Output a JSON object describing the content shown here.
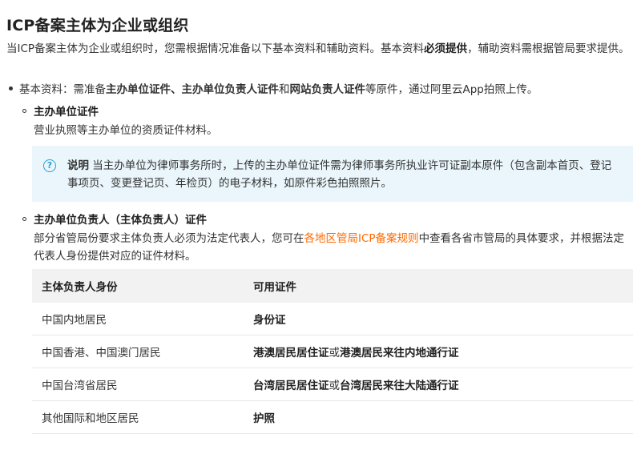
{
  "title": "ICP备案主体为企业或组织",
  "intro": {
    "part1": "当ICP备案主体为企业或组织时，您需根据情况准备以下基本资料和辅助资料。基本资料",
    "bold": "必须提供",
    "part2": "，辅助资料需根据管局要求提供。"
  },
  "basic": {
    "prefix": "基本资料：需准备",
    "b1": "主办单位证件",
    "sep1": "、",
    "b2": "主办单位负责人证件",
    "sep2": "和",
    "b3": "网站负责人证件",
    "suffix": "等原件，通过阿里云App拍照上传。"
  },
  "unit_cert": {
    "title": "主办单位证件",
    "desc": "营业执照等主办单位的资质证件材料。"
  },
  "note": {
    "icon": "question-circle-icon",
    "label": "说明",
    "text": " 当主办单位为律师事务所时，上传的主办单位证件需为律师事务所执业许可证副本原件（包含副本首页、登记事项页、变更登记页、年检页）的电子材料，如原件彩色拍照照片。"
  },
  "owner_cert": {
    "title": "主办单位负责人（主体负责人）证件",
    "desc_pre": "部分省管局份要求主体负责人必须为法定代表人，您可在",
    "link": "各地区管局ICP备案规则",
    "desc_post": "中查看各省市管局的具体要求，并根据法定代表人身份提供对应的证件材料。"
  },
  "table": {
    "headers": [
      "主体负责人身份",
      "可用证件"
    ],
    "rows": [
      {
        "identity": "中国内地居民",
        "doc1": "身份证",
        "or": "",
        "doc2": ""
      },
      {
        "identity": "中国香港、中国澳门居民",
        "doc1": "港澳居民居住证",
        "or": "或",
        "doc2": "港澳居民来往内地通行证"
      },
      {
        "identity": "中国台湾省居民",
        "doc1": "台湾居民居住证",
        "or": "或",
        "doc2": "台湾居民来往大陆通行证"
      },
      {
        "identity": "其他国际和地区居民",
        "doc1": "护照",
        "or": "",
        "doc2": ""
      }
    ]
  },
  "colors": {
    "link": "#ff6a00",
    "note_bg": "#eaf6fb",
    "note_icon": "#2a9fd6"
  }
}
